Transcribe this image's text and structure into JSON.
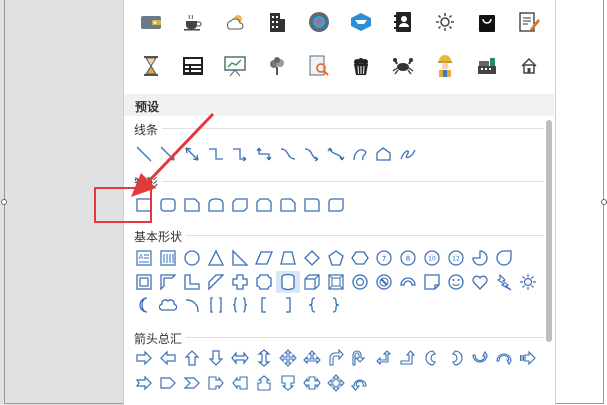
{
  "preset_section": {
    "title": "预设"
  },
  "groups": {
    "lines": {
      "label": "线条"
    },
    "rectangles": {
      "label": "矩形"
    },
    "basic_shapes": {
      "label": "基本形状"
    },
    "block_arrows": {
      "label": "箭头总汇"
    }
  },
  "icon_rows": [
    [
      "wallet-icon",
      "coffee-cup-icon",
      "weather-icon",
      "office-building-icon",
      "vinyl-record-icon",
      "cube-badge-icon",
      "contact-card-icon",
      "sun-icon",
      "shopping-bag-icon",
      "edit-document-icon"
    ],
    [
      "hourglass-icon",
      "sale-sign-icon",
      "presentation-chart-icon",
      "tree-icon",
      "magnifier-document-icon",
      "popcorn-icon",
      "crab-icon",
      "worker-icon",
      "cash-register-icon",
      "house-icon"
    ]
  ],
  "colors": {
    "accent_red": "#e23a3a",
    "shape_stroke": "#3a6fb8",
    "selected_shape_bg": "#d9e6f5"
  }
}
